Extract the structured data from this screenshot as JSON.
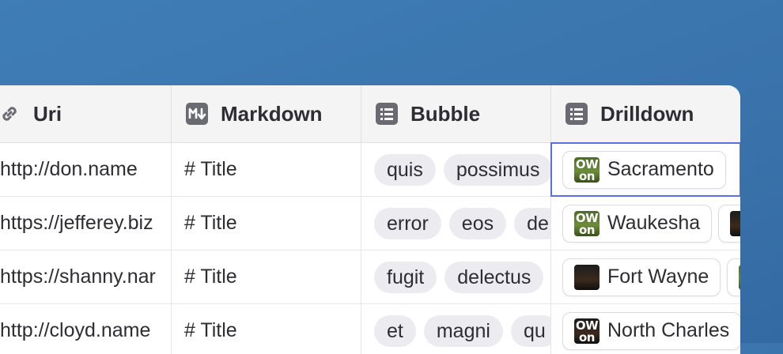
{
  "columns": [
    {
      "label": "Uri",
      "icon": "link-icon"
    },
    {
      "label": "Markdown",
      "icon": "markdown-icon"
    },
    {
      "label": "Bubble",
      "icon": "list-icon"
    },
    {
      "label": "Drilldown",
      "icon": "list-icon"
    }
  ],
  "rows": [
    {
      "uri": "http://don.name",
      "markdown": "# Title",
      "bubbles": [
        "quis",
        "possimus"
      ],
      "drilldown": [
        "Sacramento"
      ]
    },
    {
      "uri": "https://jefferey.biz",
      "markdown": "# Title",
      "bubbles": [
        "error",
        "eos",
        "de"
      ],
      "drilldown": [
        "Waukesha",
        ""
      ]
    },
    {
      "uri": "https://shanny.nar",
      "markdown": "# Title",
      "bubbles": [
        "fugit",
        "delectus"
      ],
      "drilldown": [
        "Fort Wayne",
        ""
      ]
    },
    {
      "uri": "http://cloyd.name",
      "markdown": "# Title",
      "bubbles": [
        "et",
        "magni",
        "qu"
      ],
      "drilldown": [
        "North Charles"
      ]
    }
  ],
  "avatar_text": {
    "top": "OW",
    "bottom": "on"
  },
  "colors": {
    "background": "#3a73ab",
    "selection": "#5b6ee8",
    "chip": "#ececf0"
  }
}
